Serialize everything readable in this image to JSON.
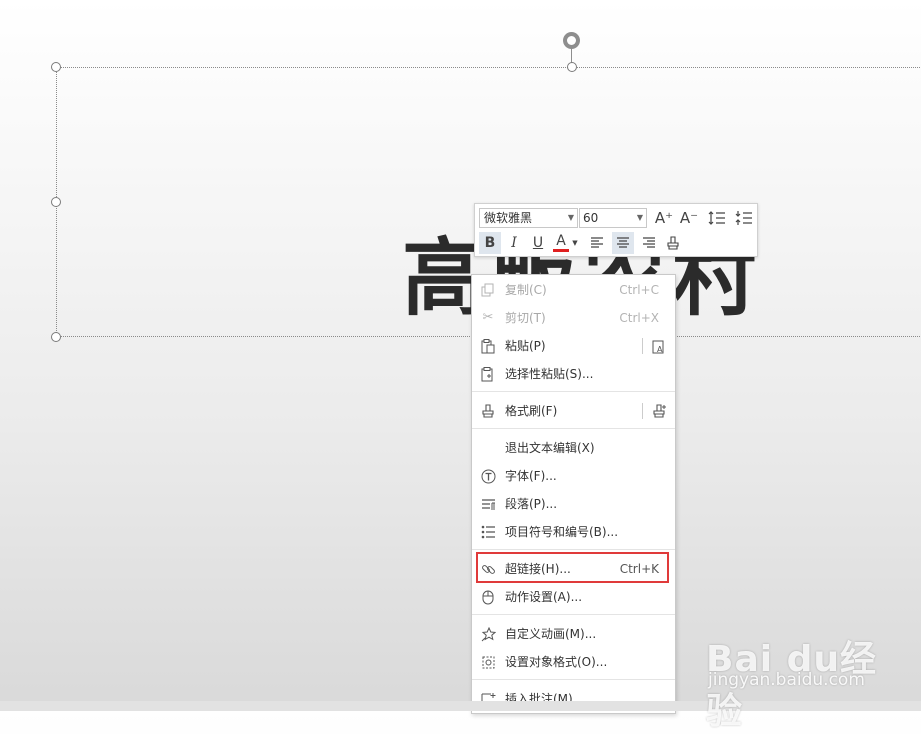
{
  "slide": {
    "title_text": "高畈农村"
  },
  "mini_toolbar": {
    "font_name": "微软雅黑",
    "font_size": "60",
    "grow_font_icon": "A⁺",
    "shrink_font_icon": "A⁻",
    "bold": "B",
    "italic": "I",
    "underline": "U",
    "font_color": "A"
  },
  "menu": {
    "copy": {
      "label": "复制(C)",
      "shortcut": "Ctrl+C"
    },
    "cut": {
      "label": "剪切(T)",
      "shortcut": "Ctrl+X"
    },
    "paste": {
      "label": "粘贴(P)"
    },
    "paste_special": {
      "label": "选择性粘贴(S)..."
    },
    "format_painter": {
      "label": "格式刷(F)"
    },
    "exit_edit": {
      "label": "退出文本编辑(X)"
    },
    "font": {
      "label": "字体(F)..."
    },
    "paragraph": {
      "label": "段落(P)..."
    },
    "bullets": {
      "label": "项目符号和编号(B)..."
    },
    "hyperlink": {
      "label": "超链接(H)...",
      "shortcut": "Ctrl+K"
    },
    "action_settings": {
      "label": "动作设置(A)..."
    },
    "custom_animation": {
      "label": "自定义动画(M)..."
    },
    "format_object": {
      "label": "设置对象格式(O)..."
    },
    "insert_comment": {
      "label": "插入批注(M)"
    }
  },
  "watermark": {
    "logo": "Bai du经验",
    "url": "jingyan.baidu.com"
  },
  "colors": {
    "highlight_box": "#e03a3a",
    "font_color_bar": "#e02020",
    "active_button": "#dfe6ee"
  }
}
